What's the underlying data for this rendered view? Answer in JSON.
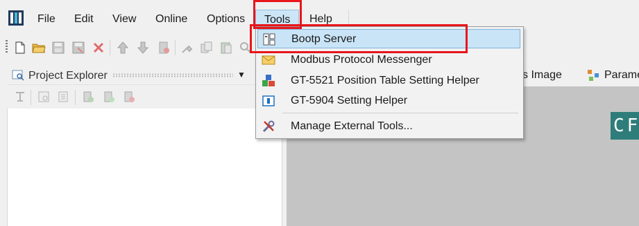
{
  "menubar": {
    "items": [
      "File",
      "Edit",
      "View",
      "Online",
      "Options",
      "Tools",
      "Help"
    ]
  },
  "panel": {
    "title": "Project Explorer",
    "pin_glyph": "▼"
  },
  "right_tabs": {
    "items": [
      "s Image",
      "Parame"
    ]
  },
  "banner": {
    "text": "CF"
  },
  "tools_menu": {
    "items": [
      {
        "label": "Bootp Server",
        "icon": "server-icon",
        "highlighted": true
      },
      {
        "label": "Modbus Protocol Messenger",
        "icon": "envelope-icon",
        "highlighted": false
      },
      {
        "label": "GT-5521 Position Table Setting Helper",
        "icon": "blocks-icon",
        "highlighted": false
      },
      {
        "label": "GT-5904 Setting Helper",
        "icon": "window-icon",
        "highlighted": false
      },
      {
        "label": "Manage External Tools...",
        "icon": "wrench-icon",
        "highlighted": false
      }
    ]
  },
  "colors": {
    "highlight": "#c9e4f6",
    "annotation_red": "#e8151b",
    "teal": "#2f7d7a"
  }
}
